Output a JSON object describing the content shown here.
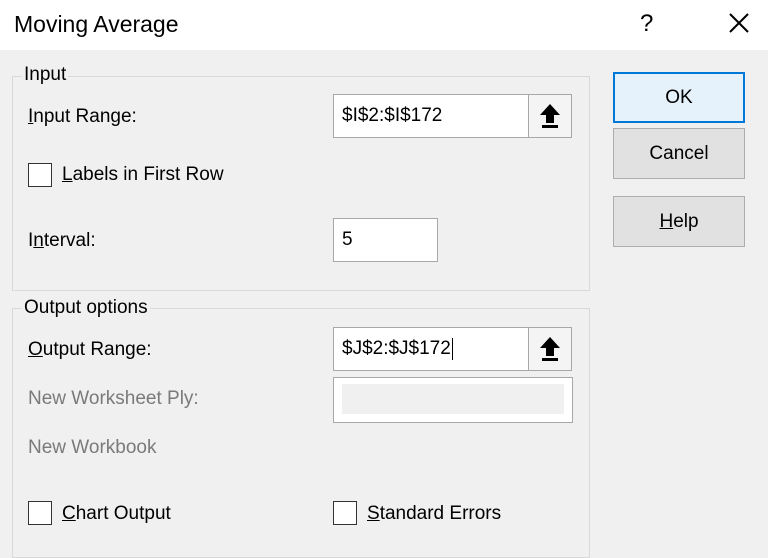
{
  "dialog": {
    "title": "Moving Average",
    "help_glyph": "?",
    "close_icon": "close-icon"
  },
  "input_group": {
    "legend": "Input",
    "input_range": {
      "label_prefix": "",
      "label_access": "I",
      "label_rest": "nput Range:",
      "value": "$I$2:$I$172",
      "picker_icon": "arrow-up-icon"
    },
    "labels_first_row": {
      "label_access": "L",
      "label_rest": "abels in First Row",
      "checked": false
    },
    "interval": {
      "label_prefix": "I",
      "label_access": "n",
      "label_rest": "terval:",
      "value": "5"
    }
  },
  "output_group": {
    "legend": "Output options",
    "output_range": {
      "label_access": "O",
      "label_rest": "utput Range:",
      "value": "$J$2:$J$172",
      "picker_icon": "arrow-up-icon"
    },
    "new_worksheet_ply": {
      "label": "New Worksheet Ply:",
      "value": ""
    },
    "new_workbook": {
      "label": "New Workbook"
    },
    "chart_output": {
      "label_access": "C",
      "label_rest": "hart Output",
      "checked": false
    },
    "standard_errors": {
      "label_access": "S",
      "label_rest": "tandard Errors",
      "checked": false
    }
  },
  "buttons": {
    "ok": "OK",
    "cancel": "Cancel",
    "help_access": "H",
    "help_rest": "elp"
  },
  "colors": {
    "accent": "#0078d7",
    "dialog_bg": "#f0f0f0",
    "disabled_text": "#7a7a7a"
  }
}
